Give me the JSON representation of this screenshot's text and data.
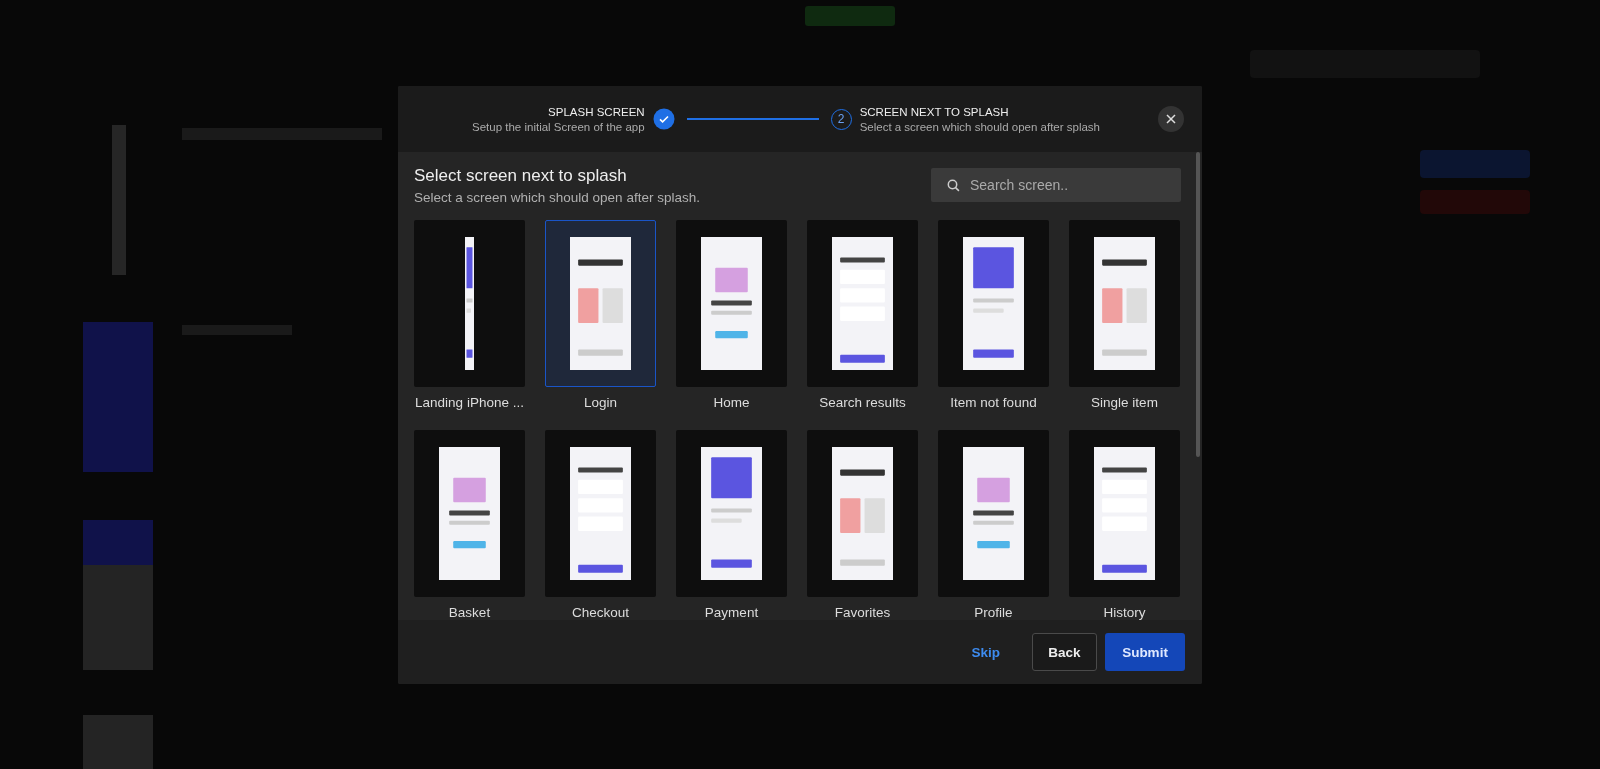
{
  "steps": [
    {
      "title": "SPLASH SCREEN",
      "subtitle": "Setup the initial Screen of the app",
      "done": true
    },
    {
      "title": "SCREEN NEXT TO SPLASH",
      "subtitle": "Select a screen which should open after splash",
      "done": false,
      "number": "2"
    }
  ],
  "heading": "Select screen next to splash",
  "subheading": "Select a screen which should open after splash.",
  "search": {
    "placeholder": "Search screen.."
  },
  "screens": [
    {
      "label": "Landing iPhone ...",
      "selected": false
    },
    {
      "label": "Login",
      "selected": true
    },
    {
      "label": "Home",
      "selected": false
    },
    {
      "label": "Search results",
      "selected": false
    },
    {
      "label": "Item not found",
      "selected": false
    },
    {
      "label": "Single item",
      "selected": false
    },
    {
      "label": "Basket",
      "selected": false
    },
    {
      "label": "Checkout",
      "selected": false
    },
    {
      "label": "Payment",
      "selected": false
    },
    {
      "label": "Favorites",
      "selected": false
    },
    {
      "label": "Profile",
      "selected": false
    },
    {
      "label": "History",
      "selected": false
    }
  ],
  "buttons": {
    "skip": "Skip",
    "back": "Back",
    "submit": "Submit"
  }
}
